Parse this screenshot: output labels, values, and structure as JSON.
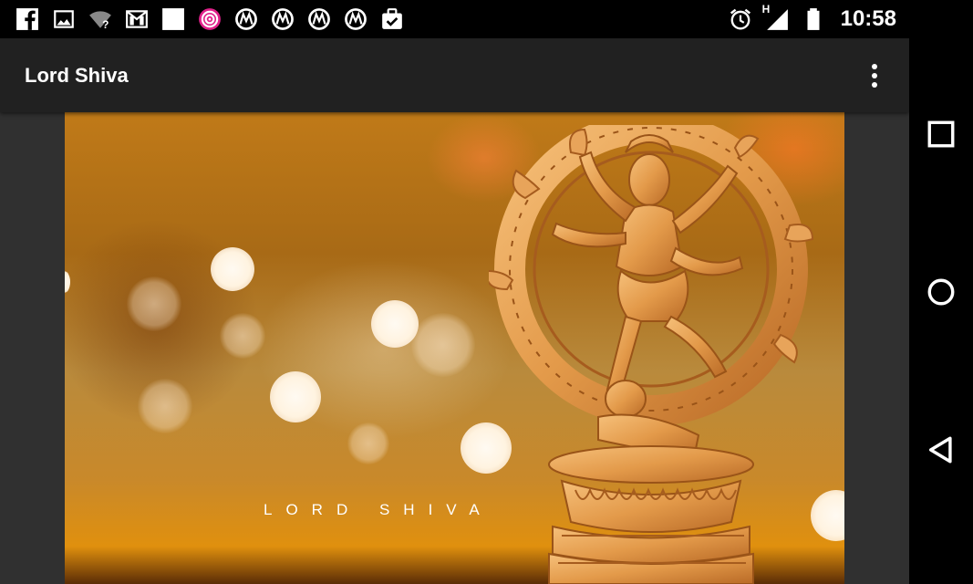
{
  "status_bar": {
    "time": "10:58",
    "network_label": "H",
    "left_icons": [
      "facebook-icon",
      "image-icon",
      "wifi-unknown-icon",
      "gmail-icon",
      "blank-square-icon",
      "target-app-icon",
      "m-app-icon",
      "m-app-icon",
      "m-app-icon",
      "m-app-icon",
      "clipboard-check-icon"
    ],
    "right_icons": [
      "alarm-icon",
      "signal-icon",
      "battery-icon"
    ]
  },
  "app_bar": {
    "title": "Lord Shiva",
    "menu_icon": "more-vert-icon"
  },
  "wallpaper": {
    "caption": "LORD SHIVA",
    "accent": "#c07a18"
  },
  "nav_bar": {
    "icons": [
      "recents-icon",
      "home-icon",
      "back-icon"
    ]
  },
  "colors": {
    "app_bar": "#212121",
    "content_bg": "#303030",
    "status_bar": "#000000"
  }
}
